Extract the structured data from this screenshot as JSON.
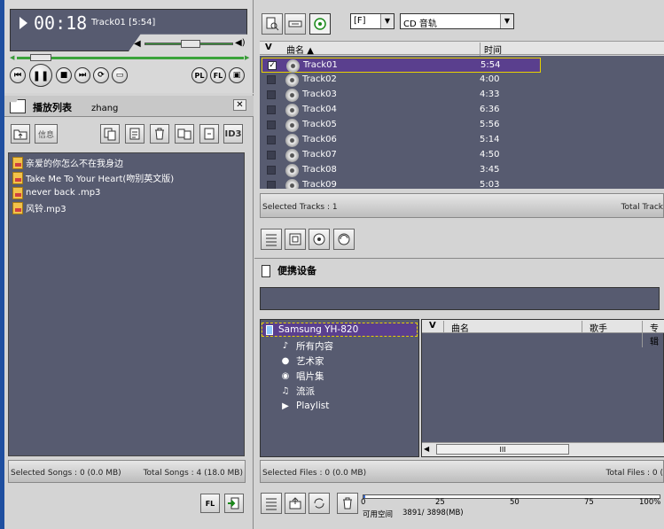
{
  "player": {
    "time": "00:18",
    "now_playing": "Track01 [5:54]",
    "buttons": {
      "pl": "PL",
      "fl": "FL"
    },
    "volume": 0.62,
    "progress": 0.06
  },
  "playlist_panel": {
    "title": "播放列表",
    "name": "zhang",
    "info_label": "信息",
    "id3_label": "ID3",
    "items": [
      "亲爱的你怎么不在我身边",
      "Take Me To Your Heart(吻别英文版)",
      "never back .mp3",
      "风铃.mp3"
    ],
    "status_left": "Selected Songs : 0 (0.0 MB)",
    "status_right": "Total Songs : 4 (18.0 MB)",
    "fl_label": "FL"
  },
  "cd_panel": {
    "drive": "[F]",
    "source": "CD 音轨",
    "col_check": "V",
    "col_name": "曲名",
    "col_time": "时间",
    "tracks": [
      {
        "name": "Track01",
        "time": "5:54",
        "checked": true
      },
      {
        "name": "Track02",
        "time": "4:00",
        "checked": false
      },
      {
        "name": "Track03",
        "time": "4:33",
        "checked": false
      },
      {
        "name": "Track04",
        "time": "6:36",
        "checked": false
      },
      {
        "name": "Track05",
        "time": "5:56",
        "checked": false
      },
      {
        "name": "Track06",
        "time": "5:14",
        "checked": false
      },
      {
        "name": "Track07",
        "time": "4:50",
        "checked": false
      },
      {
        "name": "Track08",
        "time": "3:45",
        "checked": false
      },
      {
        "name": "Track09",
        "time": "5:03",
        "checked": false
      }
    ],
    "status_left": "Selected Tracks : 1",
    "status_right": "Total Track"
  },
  "portable_panel": {
    "title": "便携设备",
    "device": "Samsung YH-820",
    "tree": [
      "所有内容",
      "艺术家",
      "唱片集",
      "流派",
      "Playlist"
    ],
    "col_check": "V",
    "col_name": "曲名",
    "col_artist": "歌手",
    "col_album": "专辑",
    "hscroll_mid": "III",
    "status_left": "Selected Files : 0 (0.0 MB)",
    "status_right": "Total Files : 0 (",
    "capacity_ticks": [
      "0",
      "25",
      "50",
      "75",
      "100%"
    ],
    "capacity_label": "可用空间",
    "capacity_value": "3891/ 3898(MB)"
  },
  "colors": {
    "panel_dark": "#575b70",
    "selection": "#5a3f8e",
    "highlight_border": "#e8d200"
  }
}
